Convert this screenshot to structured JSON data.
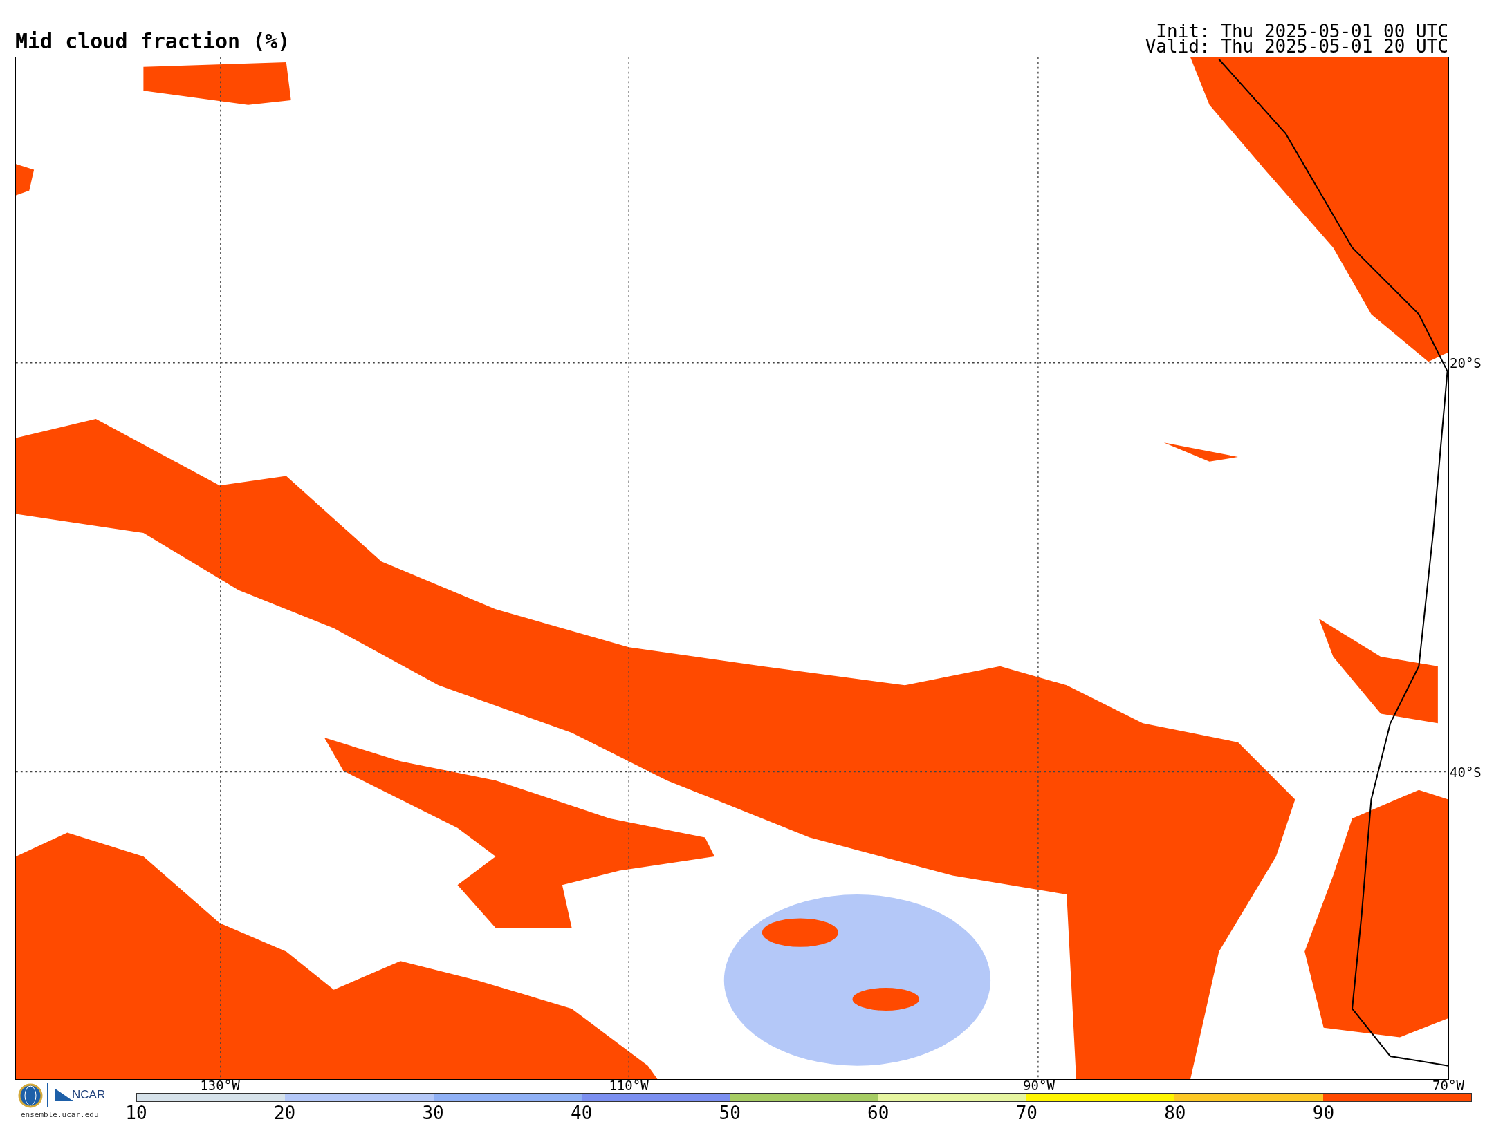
{
  "title": "Mid cloud fraction (%)",
  "init": "Init: Thu 2025-05-01 00 UTC",
  "valid": "Valid: Thu 2025-05-01 20 UTC",
  "map": {
    "lat_labels": [
      "20°S",
      "40°S"
    ],
    "lon_labels": [
      "130°W",
      "110°W",
      "90°W",
      "70°W"
    ]
  },
  "logos": {
    "org": "NCAR",
    "url": "ensemble.ucar.edu"
  },
  "colorbar": {
    "bins": [
      {
        "color": "#d6e2ea"
      },
      {
        "color": "#b4c8f8"
      },
      {
        "color": "#8fb0f5"
      },
      {
        "color": "#7b8ff0"
      },
      {
        "color": "#a6cc63"
      },
      {
        "color": "#e6f5a0"
      },
      {
        "color": "#fff500"
      },
      {
        "color": "#fcc825"
      },
      {
        "color": "#ff4a00"
      }
    ],
    "ticks": [
      "10",
      "20",
      "30",
      "40",
      "50",
      "60",
      "70",
      "80",
      "90"
    ]
  }
}
